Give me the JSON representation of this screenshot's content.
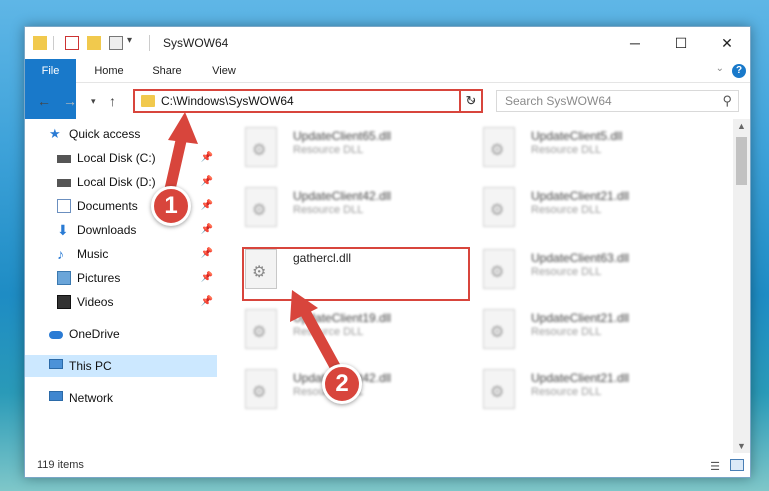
{
  "window": {
    "title": "SysWOW64"
  },
  "ribbon": {
    "tabs": [
      "File",
      "Home",
      "Share",
      "View"
    ]
  },
  "nav": {
    "address": "C:\\Windows\\SysWOW64",
    "search_placeholder": "Search SysWOW64"
  },
  "sidebar": {
    "items": [
      {
        "label": "Quick access",
        "icon": "star-icon",
        "pinned": false
      },
      {
        "label": "Local Disk (C:)",
        "icon": "drive-icon",
        "pinned": true
      },
      {
        "label": "Local Disk (D:)",
        "icon": "drive-icon",
        "pinned": true
      },
      {
        "label": "Documents",
        "icon": "documents-icon",
        "pinned": true
      },
      {
        "label": "Downloads",
        "icon": "download-icon",
        "pinned": true
      },
      {
        "label": "Music",
        "icon": "music-icon",
        "pinned": true
      },
      {
        "label": "Pictures",
        "icon": "pictures-icon",
        "pinned": true
      },
      {
        "label": "Videos",
        "icon": "videos-icon",
        "pinned": true
      },
      {
        "label": "OneDrive",
        "icon": "cloud-icon",
        "pinned": false
      },
      {
        "label": "This PC",
        "icon": "computer-icon",
        "pinned": false
      },
      {
        "label": "Network",
        "icon": "network-icon",
        "pinned": false
      }
    ]
  },
  "files": [
    {
      "name": "UpdateClient65.dll",
      "type": "Resource DLL"
    },
    {
      "name": "UpdateClient5.dll",
      "type": "Resource DLL"
    },
    {
      "name": "UpdateClient42.dll",
      "type": "Resource DLL"
    },
    {
      "name": "UpdateClient21.dll",
      "type": "Resource DLL"
    },
    {
      "name": "gathercl.dll",
      "type": ""
    },
    {
      "name": "UpdateClient63.dll",
      "type": "Resource DLL"
    },
    {
      "name": "UpdateClient19.dll",
      "type": "Resource DLL"
    },
    {
      "name": "UpdateClient21.dll",
      "type": "Resource DLL"
    },
    {
      "name": "UpdateClient42.dll",
      "type": "Resource DLL"
    },
    {
      "name": "UpdateClient21.dll",
      "type": "Resource DLL"
    }
  ],
  "status": {
    "item_count": "119 items"
  },
  "annotations": {
    "step1": "1",
    "step2": "2"
  },
  "colors": {
    "accent": "#1979ca",
    "annotation": "#d8453c",
    "selection": "#cce8ff"
  }
}
